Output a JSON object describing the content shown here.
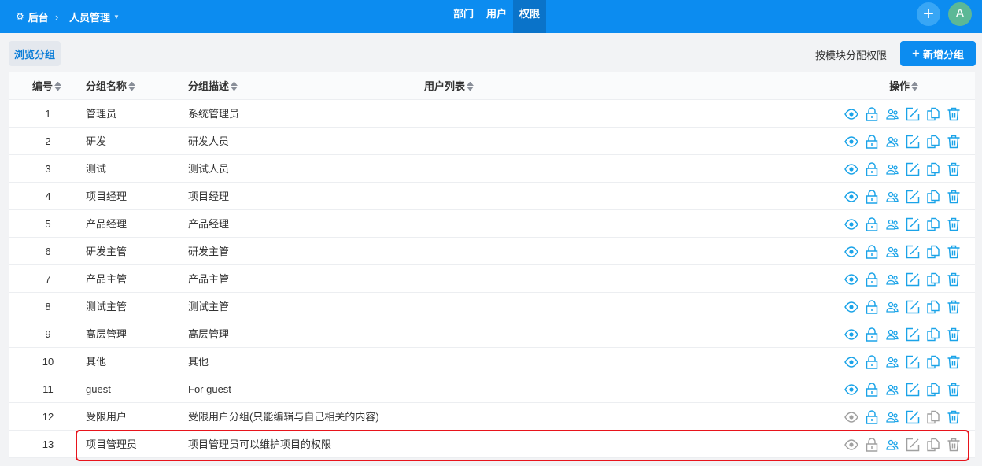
{
  "header": {
    "home": "后台",
    "section": "人员管理",
    "tabs": [
      "部门",
      "用户",
      "权限"
    ],
    "active_tab": "权限",
    "avatar": "A"
  },
  "toolbar": {
    "browse": "浏览分组",
    "assign": "按模块分配权限",
    "add": "新增分组"
  },
  "columns": {
    "id": "编号",
    "name": "分组名称",
    "desc": "分组描述",
    "users": "用户列表",
    "ops": "操作"
  },
  "colors": {
    "brand": "#0c8cf0",
    "icon_active": "#1aa3e8",
    "icon_disabled": "#a0a0a0",
    "highlight": "#e8141c"
  },
  "actions": [
    "view",
    "privilege",
    "members",
    "edit",
    "copy",
    "delete"
  ],
  "rows": [
    {
      "id": "1",
      "name": "管理员",
      "desc": "系统管理员",
      "enabled": [
        1,
        1,
        1,
        1,
        1,
        1
      ]
    },
    {
      "id": "2",
      "name": "研发",
      "desc": "研发人员",
      "enabled": [
        1,
        1,
        1,
        1,
        1,
        1
      ]
    },
    {
      "id": "3",
      "name": "测试",
      "desc": "测试人员",
      "enabled": [
        1,
        1,
        1,
        1,
        1,
        1
      ]
    },
    {
      "id": "4",
      "name": "项目经理",
      "desc": "项目经理",
      "enabled": [
        1,
        1,
        1,
        1,
        1,
        1
      ]
    },
    {
      "id": "5",
      "name": "产品经理",
      "desc": "产品经理",
      "enabled": [
        1,
        1,
        1,
        1,
        1,
        1
      ]
    },
    {
      "id": "6",
      "name": "研发主管",
      "desc": "研发主管",
      "enabled": [
        1,
        1,
        1,
        1,
        1,
        1
      ]
    },
    {
      "id": "7",
      "name": "产品主管",
      "desc": "产品主管",
      "enabled": [
        1,
        1,
        1,
        1,
        1,
        1
      ]
    },
    {
      "id": "8",
      "name": "测试主管",
      "desc": "测试主管",
      "enabled": [
        1,
        1,
        1,
        1,
        1,
        1
      ]
    },
    {
      "id": "9",
      "name": "高层管理",
      "desc": "高层管理",
      "enabled": [
        1,
        1,
        1,
        1,
        1,
        1
      ]
    },
    {
      "id": "10",
      "name": "其他",
      "desc": "其他",
      "enabled": [
        1,
        1,
        1,
        1,
        1,
        1
      ]
    },
    {
      "id": "11",
      "name": "guest",
      "desc": "For guest",
      "enabled": [
        1,
        1,
        1,
        1,
        1,
        1
      ]
    },
    {
      "id": "12",
      "name": "受限用户",
      "desc": "受限用户分组(只能编辑与自己相关的内容)",
      "enabled": [
        0,
        1,
        1,
        1,
        0,
        1
      ]
    },
    {
      "id": "13",
      "name": "项目管理员",
      "desc": "项目管理员可以维护项目的权限",
      "enabled": [
        0,
        0,
        1,
        0,
        0,
        0
      ]
    }
  ]
}
